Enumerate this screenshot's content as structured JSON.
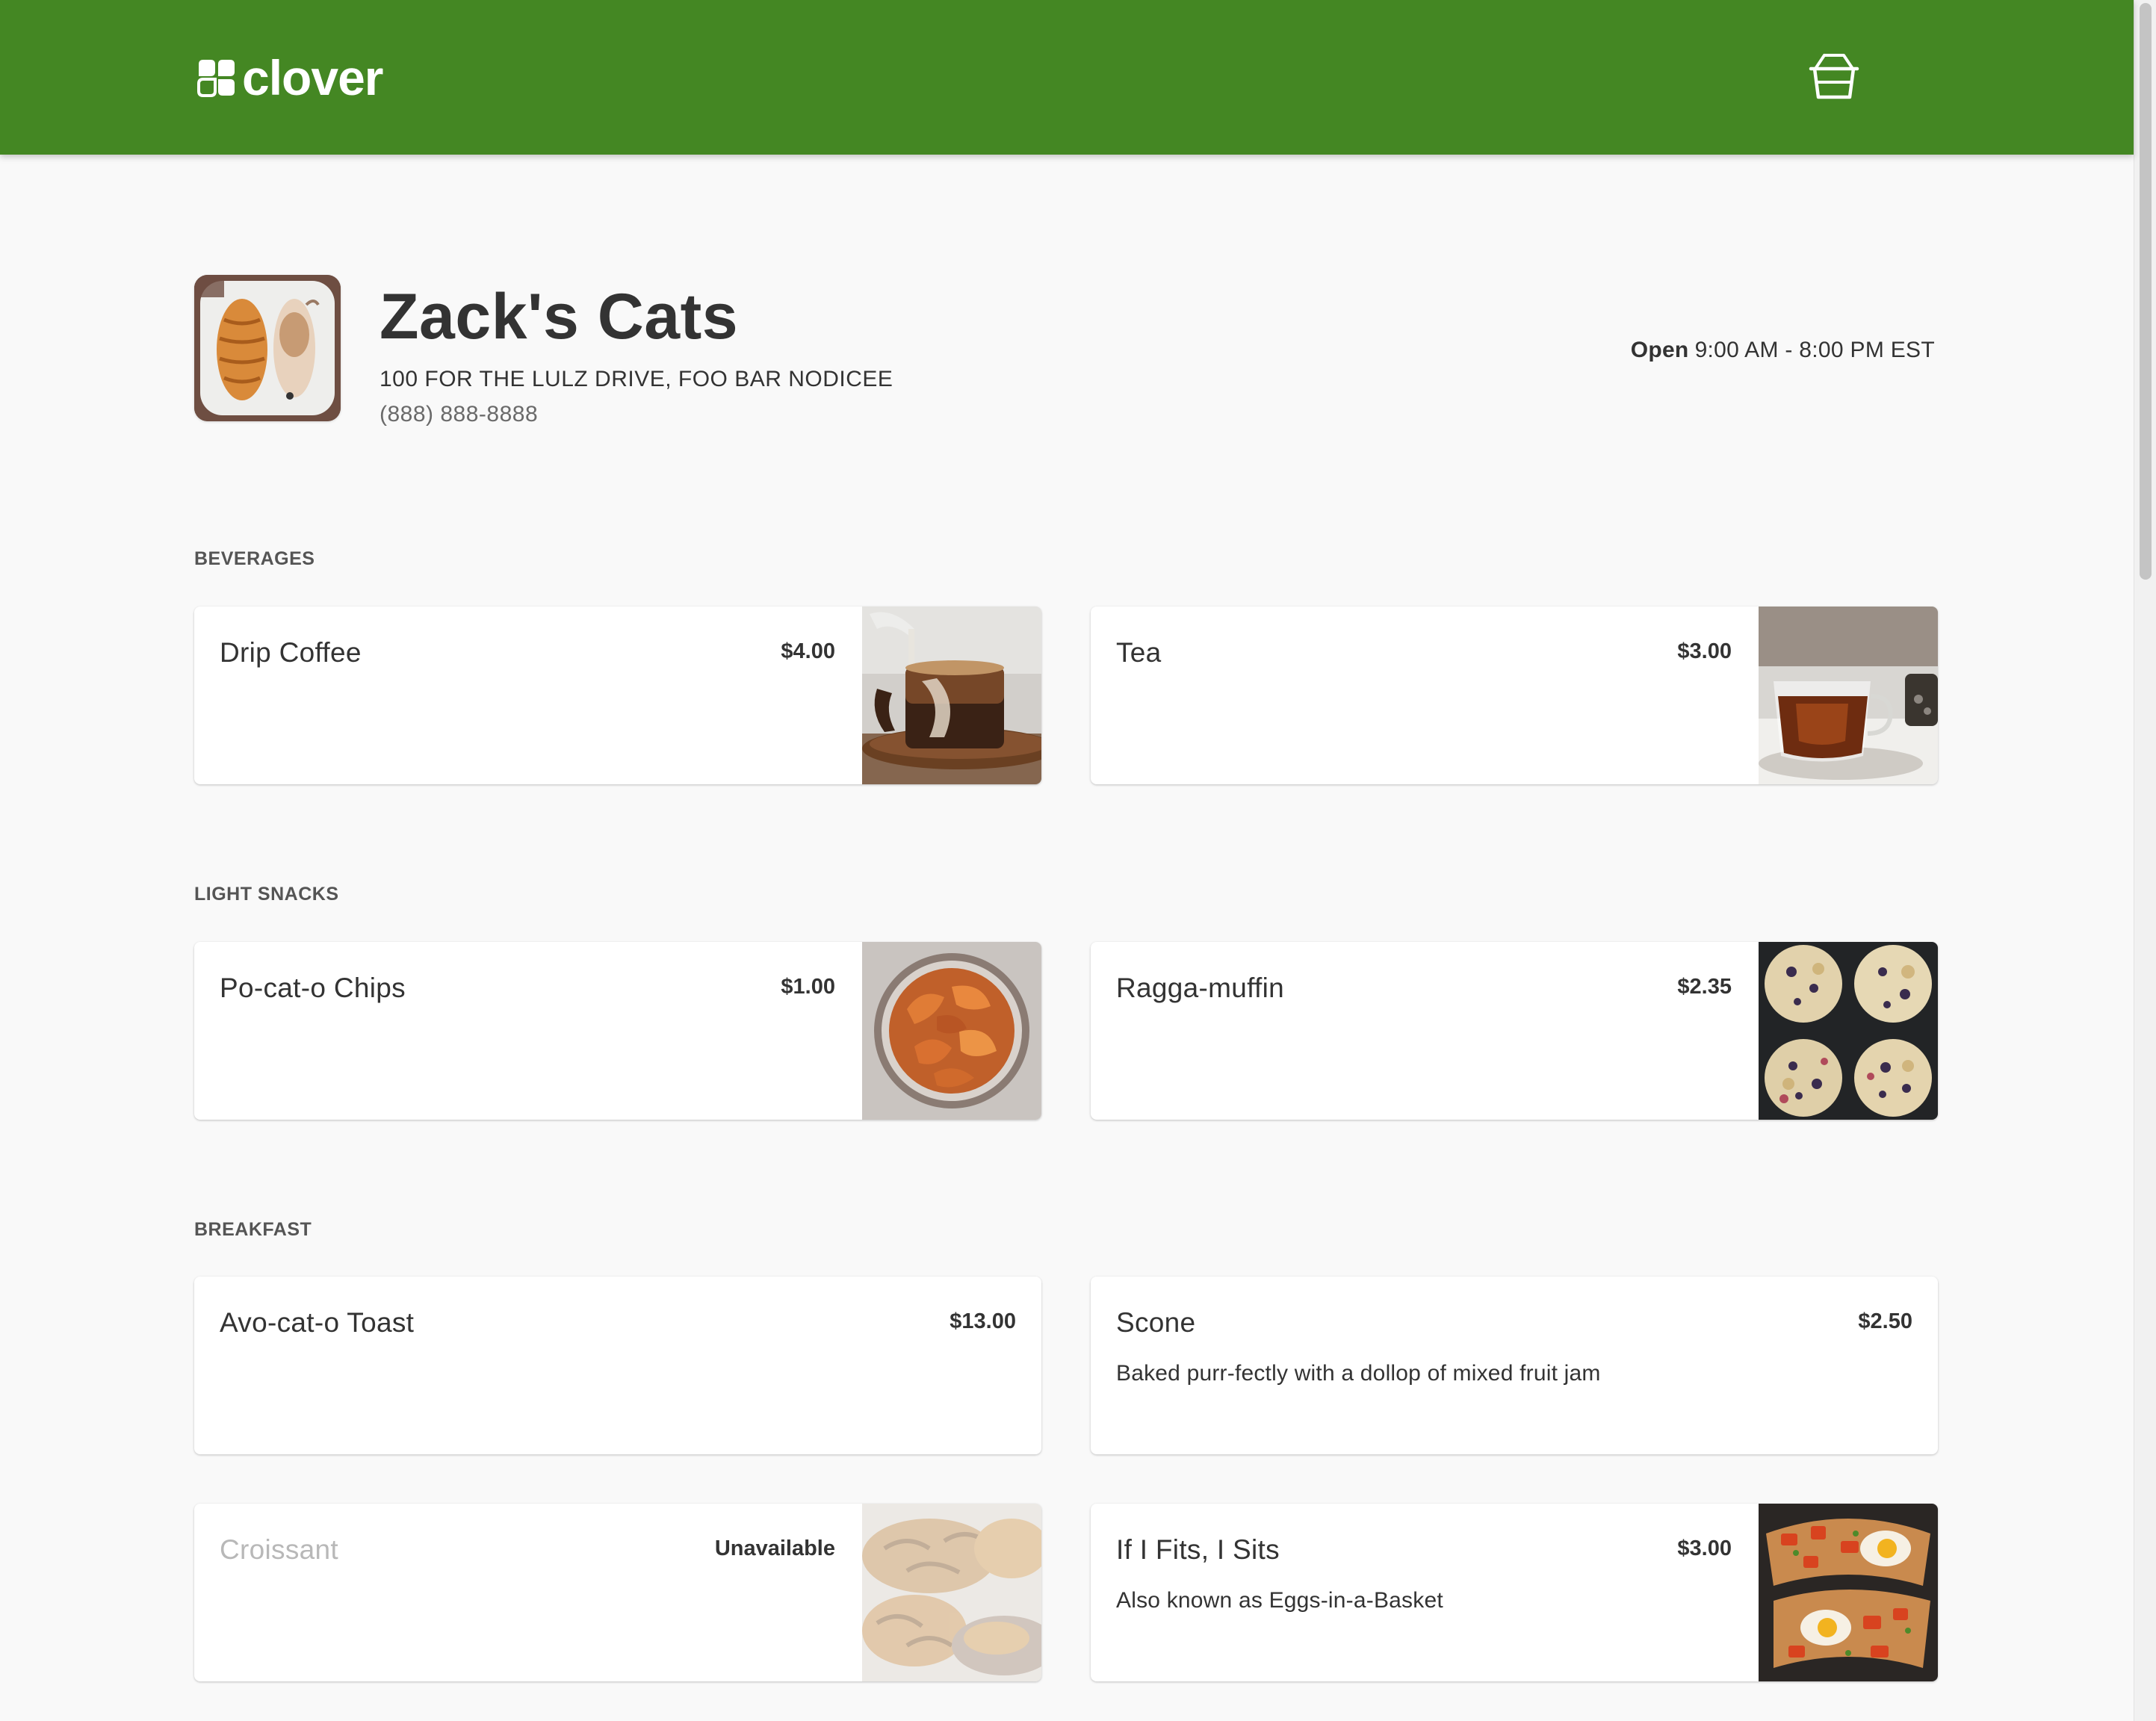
{
  "header": {
    "brand": "clover",
    "logo_icon": "clover-logo-icon",
    "cart_icon": "basket-icon",
    "background_color": "#448723"
  },
  "merchant": {
    "name": "Zack's Cats",
    "address": "100 FOR THE LULZ DRIVE, FOO BAR NODICEE",
    "phone": "(888) 888-8888",
    "hours_status": "Open",
    "hours": "9:00 AM - 8:00 PM EST",
    "logo_icon": "croissant-cat-logo"
  },
  "sections": [
    {
      "title": "BEVERAGES",
      "items": [
        {
          "name": "Drip Coffee",
          "price": "$4.00",
          "image": "coffee-cup-image"
        },
        {
          "name": "Tea",
          "price": "$3.00",
          "image": "tea-cup-image"
        }
      ]
    },
    {
      "title": "LIGHT SNACKS",
      "items": [
        {
          "name": "Po-cat-o Chips",
          "price": "$1.00",
          "image": "chips-bowl-image"
        },
        {
          "name": "Ragga-muffin",
          "price": "$2.35",
          "image": "muffins-image"
        }
      ]
    },
    {
      "title": "BREAKFAST",
      "items": [
        {
          "name": "Avo-cat-o Toast",
          "price": "$13.00"
        },
        {
          "name": "Scone",
          "price": "$2.50",
          "description": "Baked purr-fectly with a dollop of mixed fruit jam"
        },
        {
          "name": "Croissant",
          "price": "Unavailable",
          "image": "croissants-image",
          "available": false
        },
        {
          "name": "If I Fits, I Sits",
          "price": "$3.00",
          "description": "Also known as Eggs-in-a-Basket",
          "image": "eggs-in-basket-image"
        }
      ]
    }
  ]
}
